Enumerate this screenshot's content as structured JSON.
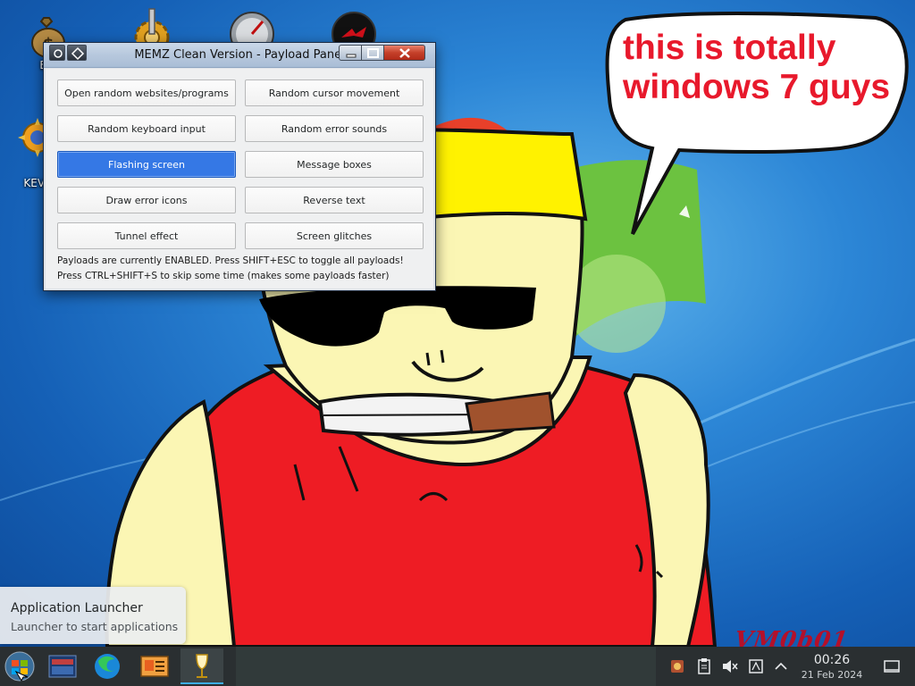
{
  "desktop": {
    "icons": [
      {
        "label": "Big",
        "label2": "D",
        "name": "money-bag"
      },
      {
        "label": "",
        "name": "gear-cog"
      },
      {
        "label": "",
        "name": "speedometer"
      },
      {
        "label": "",
        "name": "red-dragon-logo"
      },
      {
        "label": "KEVI",
        "name": "sun-badge"
      }
    ],
    "bubble_text_line1": "this is totally",
    "bubble_text_line2": "windows 7 guys",
    "watermark": "VM0b01"
  },
  "window": {
    "title": "MEMZ Clean Version - Payload Panel",
    "payloads": [
      {
        "label": "Open random websites/programs",
        "active": false
      },
      {
        "label": "Random cursor movement",
        "active": false
      },
      {
        "label": "Random keyboard input",
        "active": false
      },
      {
        "label": "Random error sounds",
        "active": false
      },
      {
        "label": "Flashing screen",
        "active": true
      },
      {
        "label": "Message boxes",
        "active": false
      },
      {
        "label": "Draw error icons",
        "active": false
      },
      {
        "label": "Reverse text",
        "active": false
      },
      {
        "label": "Tunnel effect",
        "active": false
      },
      {
        "label": "Screen glitches",
        "active": false
      }
    ],
    "status_line1": "Payloads are currently ENABLED. Press SHIFT+ESC to toggle all payloads!",
    "status_line2": "Press CTRL+SHIFT+S to skip some time (makes some payloads faster)"
  },
  "tooltip": {
    "title": "Application Launcher",
    "subtitle": "Launcher to start applications"
  },
  "taskbar": {
    "apps": [
      {
        "name": "application-launcher"
      },
      {
        "name": "file-manager"
      },
      {
        "name": "browser"
      },
      {
        "name": "system-info"
      },
      {
        "name": "wine-glass"
      }
    ],
    "clock_time": "00:26",
    "clock_date": "21 Feb 2024"
  },
  "colors": {
    "active_button": "#3578e5",
    "bubble_text": "#e8192c",
    "taskbar": "#2a2f31"
  }
}
